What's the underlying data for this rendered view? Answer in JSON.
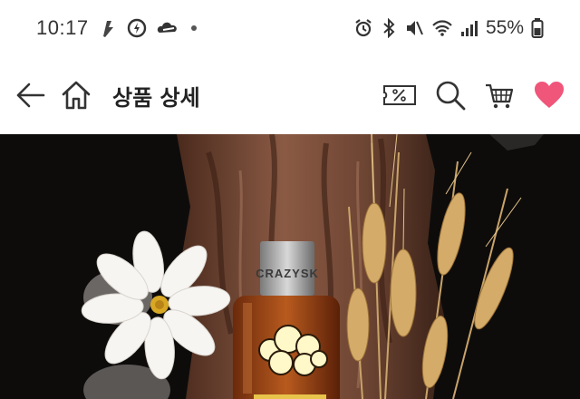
{
  "status_bar": {
    "time": "10:17",
    "battery": "55%"
  },
  "header": {
    "title": "상품 상세",
    "accent_heart": "#f0557a"
  },
  "product": {
    "bottle_label": "CRAZYSK"
  },
  "icons": [
    "back-arrow-icon",
    "home-icon",
    "coupon-icon",
    "search-icon",
    "cart-icon",
    "heart-icon"
  ]
}
